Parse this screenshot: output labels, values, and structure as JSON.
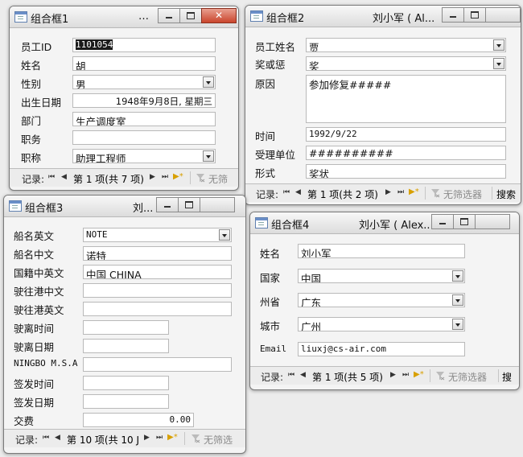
{
  "windows": {
    "w1": {
      "title": "组合框1",
      "title_trail": "…",
      "close_glyph": "✕",
      "labels": [
        "员工ID",
        "姓名",
        "性别",
        "出生日期",
        "部门",
        "职务",
        "职称"
      ],
      "values": [
        "1101054",
        "胡",
        "男",
        "1948年9月8日, 星期三",
        "生产调度室",
        "",
        "助理工程师"
      ],
      "nav": {
        "label": "记录:",
        "first": "⏮",
        "prev": "◀",
        "position": "第 1 项(共 7 项)",
        "next": "▶",
        "last": "⏭",
        "new": "▶*",
        "filter": "无筛"
      }
    },
    "w2": {
      "title": "组合框2",
      "user": "刘小军 ( Al...",
      "labels": [
        "员工姓名",
        "奖或惩",
        "原因",
        "时间",
        "受理单位",
        "形式"
      ],
      "values": [
        "贾",
        "奖",
        "参加修复#####",
        "1992/9/22",
        "##########",
        "奖状"
      ],
      "nav": {
        "label": "记录:",
        "first": "⏮",
        "prev": "◀",
        "position": "第 1 项(共 2 项)",
        "next": "▶",
        "last": "⏭",
        "new": "▶*",
        "filter": "无筛选器",
        "search": "搜索"
      }
    },
    "w3": {
      "title": "组合框3",
      "user": "刘...",
      "labels": [
        "船名英文",
        "船名中文",
        "国籍中英文",
        "驶往港中文",
        "驶往港英文",
        "驶离时间",
        "驶离日期",
        "NINGBO M.S.A",
        "签发时间",
        "签发日期",
        "交费"
      ],
      "values": [
        "NOTE",
        "诺特",
        "中国 CHINA",
        "",
        "",
        "",
        "",
        "",
        "",
        "",
        "0.00"
      ],
      "nav": {
        "label": "记录:",
        "first": "⏮",
        "prev": "◀",
        "position": "第 10 项(共 10 J",
        "next": "▶",
        "last": "⏭",
        "new": "▶*",
        "filter": "无筛选"
      }
    },
    "w4": {
      "title": "组合框4",
      "user": "刘小军 ( Alex...",
      "labels": [
        "姓名",
        "国家",
        "州省",
        "城市",
        "Email"
      ],
      "values": [
        "刘小军",
        "中国",
        "广东",
        "广州",
        "liuxj@cs-air.com"
      ],
      "nav": {
        "label": "记录:",
        "first": "⏮",
        "prev": "◀",
        "position": "第 1 项(共 5 项)",
        "next": "▶",
        "last": "⏭",
        "new": "▶*",
        "filter": "无筛选器",
        "search": "搜"
      }
    }
  }
}
